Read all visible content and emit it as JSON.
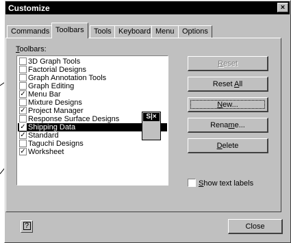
{
  "window": {
    "title": "Customize",
    "close_glyph": "×"
  },
  "tabs": [
    {
      "label": "Commands",
      "active": false
    },
    {
      "label": "Toolbars",
      "active": true
    },
    {
      "label": "Tools",
      "active": false
    },
    {
      "label": "Keyboard",
      "active": false
    },
    {
      "label": "Menu",
      "active": false
    },
    {
      "label": "Options",
      "active": false
    }
  ],
  "toolbars_label": {
    "accel": "T",
    "rest": "oolbars:"
  },
  "toolbar_list": [
    {
      "label": "3D Graph Tools",
      "checked": false,
      "selected": false
    },
    {
      "label": "Factorial Designs",
      "checked": false,
      "selected": false
    },
    {
      "label": "Graph Annotation Tools",
      "checked": false,
      "selected": false
    },
    {
      "label": "Graph Editing",
      "checked": false,
      "selected": false
    },
    {
      "label": "Menu Bar",
      "checked": true,
      "selected": false
    },
    {
      "label": "Mixture Designs",
      "checked": false,
      "selected": false
    },
    {
      "label": "Project Manager",
      "checked": true,
      "selected": false
    },
    {
      "label": "Response Surface Designs",
      "checked": false,
      "selected": false
    },
    {
      "label": "Shipping Data",
      "checked": true,
      "selected": true
    },
    {
      "label": "Standard",
      "checked": true,
      "selected": false
    },
    {
      "label": "Taguchi Designs",
      "checked": false,
      "selected": false
    },
    {
      "label": "Worksheet",
      "checked": true,
      "selected": false
    }
  ],
  "floating_toolbar": {
    "caption": "S|×"
  },
  "buttons": {
    "reset": {
      "label": "Reset",
      "accel": "R",
      "enabled": false
    },
    "reset_all": {
      "pre": "Reset ",
      "accel": "A",
      "post": "ll"
    },
    "new": {
      "accel": "N",
      "post": "ew..."
    },
    "rename": {
      "pre": "Rena",
      "accel": "m",
      "post": "e..."
    },
    "delete": {
      "accel": "D",
      "post": "elete"
    },
    "close": {
      "label": "Close"
    }
  },
  "show_text_labels": {
    "accel": "S",
    "rest": "how text labels",
    "checked": false
  },
  "help_button": {
    "glyph": "?"
  }
}
